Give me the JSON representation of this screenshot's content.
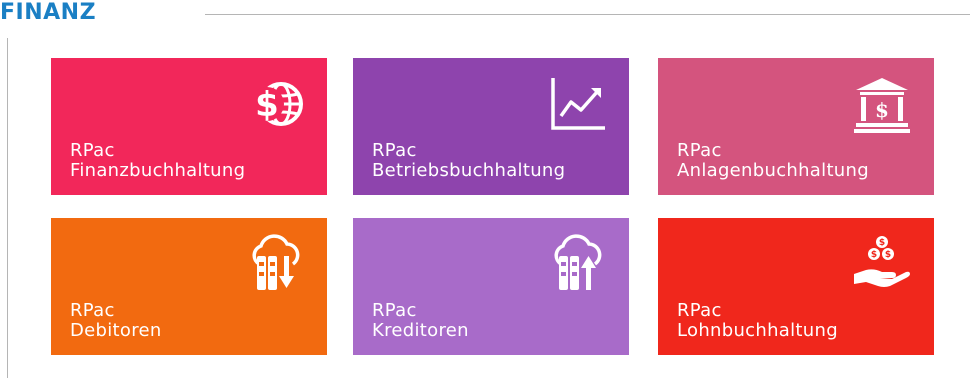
{
  "section": {
    "title": "FINANZ"
  },
  "tiles": [
    {
      "line1": "RPac",
      "line2": "Finanzbuchhaltung",
      "color": "#f2275a",
      "icon": "dollar-globe-icon"
    },
    {
      "line1": "RPac",
      "line2": "Betriebsbuchhaltung",
      "color": "#8e44ad",
      "icon": "line-chart-icon"
    },
    {
      "line1": "RPac",
      "line2": "Anlagenbuchhaltung",
      "color": "#d4547e",
      "icon": "bank-icon"
    },
    {
      "line1": "RPac",
      "line2": "Debitoren",
      "color": "#f26a10",
      "icon": "cloud-download-icon"
    },
    {
      "line1": "RPac",
      "line2": "Kreditoren",
      "color": "#a86bc9",
      "icon": "cloud-upload-icon"
    },
    {
      "line1": "RPac",
      "line2": "Lohnbuchhaltung",
      "color": "#f0271c",
      "icon": "hand-coins-icon"
    }
  ]
}
